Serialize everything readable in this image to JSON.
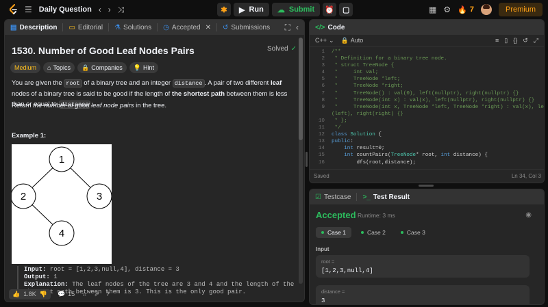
{
  "topbar": {
    "title": "Daily Question",
    "run_label": "Run",
    "submit_label": "Submit",
    "streak_count": "7",
    "premium_label": "Premium"
  },
  "description_tabs": [
    {
      "label": "Description",
      "icon": "description-icon"
    },
    {
      "label": "Editorial",
      "icon": "book-icon"
    },
    {
      "label": "Solutions",
      "icon": "flask-icon"
    },
    {
      "label": "Accepted",
      "icon": "clock-icon"
    },
    {
      "label": "Submissions",
      "icon": "history-icon"
    }
  ],
  "problem": {
    "title": "1530. Number of Good Leaf Nodes Pairs",
    "status": "Solved",
    "difficulty": "Medium",
    "chips": [
      "Topics",
      "Companies",
      "Hint"
    ],
    "p1_a": "You are given the ",
    "p1_root": "root",
    "p1_b": " of a binary tree and an integer ",
    "p1_distance": "distance",
    "p1_c": ". A pair of two different ",
    "p1_leaf": "leaf",
    "p1_d": " nodes of a binary tree is said to be good if the length of ",
    "p1_shortest": "the shortest path",
    "p1_e": " between them is less than or equal to ",
    "p1_distance2": "distance",
    "p1_f": ".",
    "p2_a": "Return ",
    "p2_em": "the number of good leaf node pairs",
    "p2_b": " in the tree.",
    "example_title": "Example 1:",
    "tree_nodes": [
      "1",
      "2",
      "3",
      "4"
    ],
    "input_label": "Input:",
    "input_value": " root = [1,2,3,null,4], distance = 3",
    "output_label": "Output:",
    "output_value": " 1",
    "explanation_label": "Explanation:",
    "explanation_value": " The leaf nodes of the tree are 3 and 4 and the length of the shortest path between them is 3. This is the only good pair."
  },
  "desc_footer": {
    "likes": "1.8K",
    "comments": "15"
  },
  "code_panel": {
    "title": "Code",
    "language": "C++",
    "mode": "Auto",
    "saved": "Saved",
    "cursor": "Ln 34, Col 3",
    "lines": [
      {
        "n": "1",
        "html": "<span class='cm'>/**</span>"
      },
      {
        "n": "2",
        "html": "<span class='cm'> * Definition for a binary tree node.</span>"
      },
      {
        "n": "3",
        "html": "<span class='cm'> * struct TreeNode {</span>"
      },
      {
        "n": "4",
        "html": "<span class='cm'> *     int val;</span>"
      },
      {
        "n": "5",
        "html": "<span class='cm'> *     TreeNode *left;</span>"
      },
      {
        "n": "6",
        "html": "<span class='cm'> *     TreeNode *right;</span>"
      },
      {
        "n": "7",
        "html": "<span class='cm'> *     TreeNode() : val(0), left(nullptr), right(nullptr) {}</span>"
      },
      {
        "n": "8",
        "html": "<span class='cm'> *     TreeNode(int x) : val(x), left(nullptr), right(nullptr) {}</span>"
      },
      {
        "n": "9",
        "html": "<span class='cm'> *     TreeNode(int x, TreeNode *left, TreeNode *right) : val(x), left</span>"
      },
      {
        "n": "",
        "html": "<span class='cm'>(left), right(right) {}</span>"
      },
      {
        "n": "10",
        "html": "<span class='cm'> * };</span>"
      },
      {
        "n": "11",
        "html": "<span class='cm'> */</span>"
      },
      {
        "n": "12",
        "html": "<span class='kw'>class</span><span class='tx'> </span><span class='ty'>Solution</span><span class='tx'> {</span>"
      },
      {
        "n": "13",
        "html": "<span class='kw'>public</span><span class='tx'>:</span>"
      },
      {
        "n": "14",
        "html": "<span class='tx'>    </span><span class='kw'>int</span><span class='tx'> result=0;</span>"
      },
      {
        "n": "15",
        "html": "<span class='tx'>    </span><span class='kw'>int</span><span class='tx'> countPairs(</span><span class='ty'>TreeNode</span><span class='tx'>* root, </span><span class='kw'>int</span><span class='tx'> distance) {</span>"
      },
      {
        "n": "16",
        "html": "<span class='tx'>        dfs(root,distance);</span>"
      }
    ]
  },
  "test_panel": {
    "tab_testcase": "Testcase",
    "tab_result": "Test Result",
    "verdict": "Accepted",
    "runtime": "Runtime: 3 ms",
    "cases": [
      "Case 1",
      "Case 2",
      "Case 3"
    ],
    "input_heading": "Input",
    "inputs": [
      {
        "key": "root =",
        "value": "[1,2,3,null,4]"
      },
      {
        "key": "distance =",
        "value": "3"
      }
    ]
  },
  "colors": {
    "accent_orange": "#ffa116",
    "accept_green": "#2cbb5d",
    "medium_yellow": "#ffc01e",
    "link_blue": "#3b8eea",
    "panel_bg": "#262626",
    "page_bg": "#0f0f0f"
  }
}
